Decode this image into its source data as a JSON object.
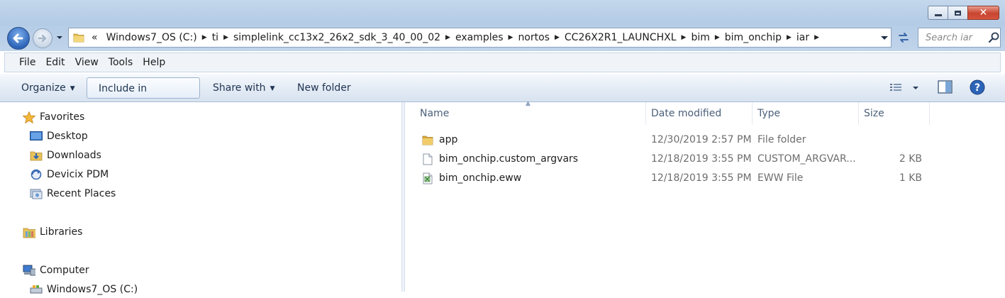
{
  "window": {
    "controls": {
      "minimize": "minimize",
      "maximize": "maximize",
      "close": "✕"
    }
  },
  "address_bar": {
    "overflow": "«",
    "crumbs": [
      "Windows7_OS (C:)",
      "ti",
      "simplelink_cc13x2_26x2_sdk_3_40_00_02",
      "examples",
      "nortos",
      "CC26X2R1_LAUNCHXL",
      "bim",
      "bim_onchip",
      "iar"
    ]
  },
  "search": {
    "placeholder": "Search iar"
  },
  "menu": {
    "items": [
      "File",
      "Edit",
      "View",
      "Tools",
      "Help"
    ]
  },
  "toolbar": {
    "organize": "Organize",
    "include_in_library": "Include in library",
    "share_with": "Share with",
    "new_folder": "New folder"
  },
  "nav": {
    "favorites": "Favorites",
    "desktop": "Desktop",
    "downloads": "Downloads",
    "devicix": "Devicix PDM",
    "recent": "Recent Places",
    "libraries": "Libraries",
    "computer": "Computer",
    "drive": "Windows7_OS (C:)"
  },
  "columns": {
    "name": "Name",
    "date": "Date modified",
    "type": "Type",
    "size": "Size"
  },
  "files": [
    {
      "name": "app",
      "date": "12/30/2019 2:57 PM",
      "type": "File folder",
      "size": "",
      "icon": "folder-icon"
    },
    {
      "name": "bim_onchip.custom_argvars",
      "date": "12/18/2019 3:55 PM",
      "type": "CUSTOM_ARGVAR...",
      "size": "2 KB",
      "icon": "blank-file-icon"
    },
    {
      "name": "bim_onchip.eww",
      "date": "12/18/2019 3:55 PM",
      "type": "EWW File",
      "size": "1 KB",
      "icon": "eww-file-icon"
    }
  ],
  "colors": {
    "accent": "#1e3350",
    "selection_border": "#9db4cf",
    "close_red": "#c8452f"
  }
}
